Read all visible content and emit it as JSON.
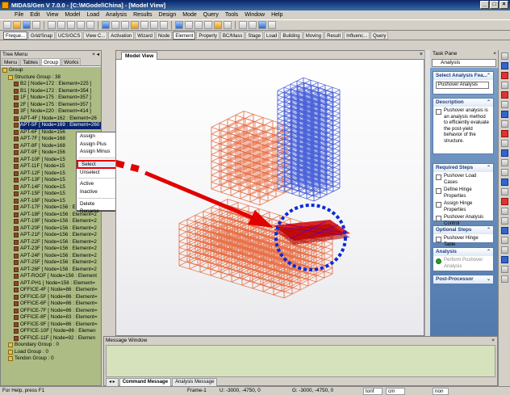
{
  "titlebar": {
    "text": "MIDAS/Gen V 7.0.0 - [C:\\MGodel\\China] - [Model View]"
  },
  "menu": [
    "File",
    "Edit",
    "View",
    "Model",
    "Load",
    "Analysis",
    "Results",
    "Design",
    "Mode",
    "Query",
    "Tools",
    "Window",
    "Help"
  ],
  "tabs": [
    "Freque...",
    "Grid/Snap",
    "UCS/GCS",
    "View C...",
    "Activation",
    "Wizard",
    "Node",
    "Element",
    "Property",
    "BC/Mass",
    "Stage",
    "Load",
    "Building",
    "Moving",
    "Result",
    "Influenc...",
    "Query"
  ],
  "tree_menu": {
    "title": "Tree Menu",
    "tabs": [
      "Menu",
      "Tables",
      "Group",
      "Works"
    ],
    "rows": [
      {
        "text": "Group",
        "indent": 0
      },
      {
        "text": "Structure Group : 38",
        "indent": 1
      },
      {
        "text": "B2 [ Node=172 : Element=225 ]",
        "indent": 2
      },
      {
        "text": "B1 [ Node=172 : Element=354 ]",
        "indent": 2
      },
      {
        "text": "1F [ Node=175 : Element=357 ]",
        "indent": 2
      },
      {
        "text": "2F [ Node=175 : Element=357 ]",
        "indent": 2
      },
      {
        "text": "3F [ Node=220 : Element=414 ]",
        "indent": 2
      },
      {
        "text": "APT-4F [ Node=162 : Element=26",
        "indent": 2
      },
      {
        "text": "APT-5F [ Node=169 : Element=260 ]",
        "indent": 2,
        "selected": true
      },
      {
        "text": "APT-6F [ Node=156",
        "indent": 2
      },
      {
        "text": "APT-7F [ Node=168",
        "indent": 2
      },
      {
        "text": "APT-8F [ Node=168",
        "indent": 2
      },
      {
        "text": "APT-9F [ Node=156",
        "indent": 2
      },
      {
        "text": "APT-10F [ Node=15",
        "indent": 2
      },
      {
        "text": "APT-11F [ Node=15",
        "indent": 2
      },
      {
        "text": "APT-12F [ Node=15",
        "indent": 2
      },
      {
        "text": "APT-13F [ Node=15",
        "indent": 2
      },
      {
        "text": "APT-14F [ Node=15",
        "indent": 2
      },
      {
        "text": "APT-15F [ Node=15",
        "indent": 2
      },
      {
        "text": "APT-16F [ Node=15",
        "indent": 2
      },
      {
        "text": "APT-17F [ Node=156 : Element=2",
        "indent": 2
      },
      {
        "text": "APT-18F [ Node=156 : Element=2",
        "indent": 2
      },
      {
        "text": "APT-19F [ Node=156 : Element=2",
        "indent": 2
      },
      {
        "text": "APT-20F [ Node=156 : Element=2",
        "indent": 2
      },
      {
        "text": "APT-21F [ Node=156 : Element=2",
        "indent": 2
      },
      {
        "text": "APT-22F [ Node=156 : Element=2",
        "indent": 2
      },
      {
        "text": "APT-23F [ Node=156 : Element=2",
        "indent": 2
      },
      {
        "text": "APT-24F [ Node=156 : Element=2",
        "indent": 2
      },
      {
        "text": "APT-25F [ Node=156 : Element=2",
        "indent": 2
      },
      {
        "text": "APT-26F [ Node=156 : Element=2",
        "indent": 2
      },
      {
        "text": "APT-ROOF [ Node=156 : Element",
        "indent": 2
      },
      {
        "text": "APT-PH1 [ Node=156 : Element=",
        "indent": 2
      },
      {
        "text": "OFFICE-4F [ Node=86 : Element=",
        "indent": 2
      },
      {
        "text": "OFFICE-5F [ Node=86 : Element=",
        "indent": 2
      },
      {
        "text": "OFFICE-6F [ Node=86 : Element=",
        "indent": 2
      },
      {
        "text": "OFFICE-7F [ Node=86 : Element=",
        "indent": 2
      },
      {
        "text": "OFFICE-8F [ Node=83 : Element=",
        "indent": 2
      },
      {
        "text": "OFFICE-9F [ Node=86 : Element=",
        "indent": 2
      },
      {
        "text": "OFFICE-10F [ Node=86 : Elemen",
        "indent": 2
      },
      {
        "text": "OFFICE-11F [ Node=92 : Elemen",
        "indent": 2
      },
      {
        "text": "Boundary Group : 0",
        "indent": 1
      },
      {
        "text": "Load Group : 0",
        "indent": 1
      },
      {
        "text": "Tendon Group : 0",
        "indent": 1
      }
    ]
  },
  "context_menu": [
    "Assign",
    "Assign Plus",
    "Assign Minus",
    "Select",
    "Unselect",
    "Active",
    "Inactive",
    "Delete",
    "Rename"
  ],
  "model_view": {
    "tab": "Model View"
  },
  "task_pane": {
    "title": "Task Pane",
    "combo": "Analysis",
    "select_header": "Select Analysis Fea...",
    "select_value": "Pushover Analysis",
    "description_header": "Description",
    "description": "Pushover analysis is an analysis method to efficiently evaluate the post-yield behavior of the structure.",
    "required_header": "Required Steps",
    "required": [
      "Pushover Load Cases",
      "Define Hinge Properties",
      "Assign Hinge Properties",
      "Pushover Analysis Control"
    ],
    "optional_header": "Optional Steps",
    "optional": [
      "Pushover Hinge Table"
    ],
    "analysis_header": "Analysis",
    "analysis": [
      "Perform Pushover Analysis"
    ],
    "post_header": "Post-Processor"
  },
  "message_window": {
    "title": "Message Window",
    "tabs": [
      "Command Message",
      "Analysis Message"
    ]
  },
  "status": {
    "help": "For Help, press F1",
    "frame": "Frame-1",
    "u": "U: -3000, -4750, 0",
    "g": "G: -3000, -4750, 0",
    "unit1": "tonf",
    "unit2": "cm",
    "non": "non"
  },
  "colors": {
    "frame_orange": "#e8724a",
    "frame_blue": "#4a62d8",
    "selection_red": "#d40000",
    "dash_blue": "#0a2ad8"
  }
}
